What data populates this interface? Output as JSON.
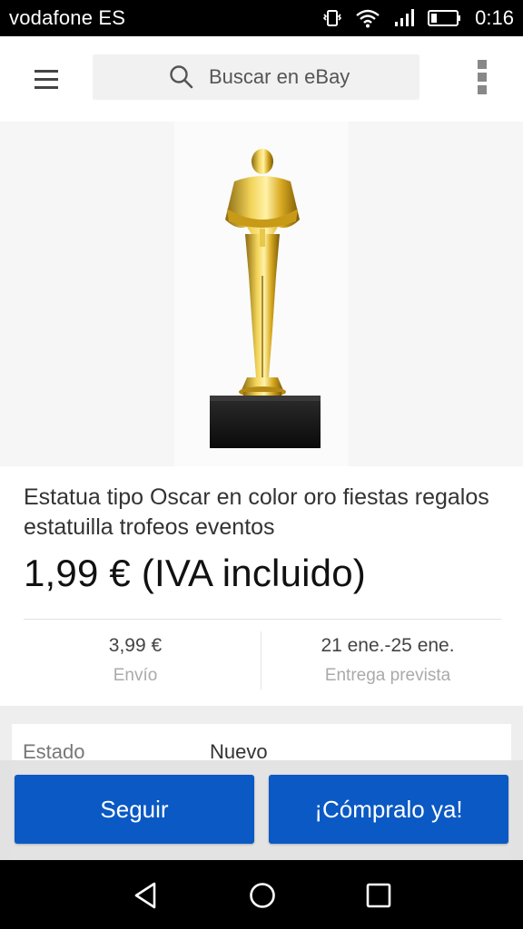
{
  "status_bar": {
    "carrier": "vodafone ES",
    "time": "0:16",
    "icons": [
      "vibrate-icon",
      "wifi-icon",
      "signal-icon",
      "battery-icon"
    ]
  },
  "app_bar": {
    "menu_icon": "hamburger-menu-icon",
    "search_placeholder": "Buscar en eBay",
    "search_icon": "search-icon",
    "overflow_icon": "overflow-menu-icon"
  },
  "product": {
    "image": "gold-trophy-statue",
    "title": "Estatua tipo Oscar en color oro fiestas regalos estatuilla trofeos eventos",
    "price": "1,99 € (IVA incluido)",
    "shipping": {
      "value": "3,99 €",
      "label": "Envío"
    },
    "delivery": {
      "value": "21 ene.-25 ene.",
      "label": "Entrega prevista"
    }
  },
  "details": {
    "rows": [
      {
        "label": "Estado",
        "value": "Nuevo"
      }
    ]
  },
  "actions": {
    "follow_label": "Seguir",
    "buy_label": "¡Cómpralo ya!",
    "button_color": "#0a59c4"
  },
  "nav_bar": {
    "icons": [
      "back-icon",
      "home-icon",
      "recents-icon"
    ]
  }
}
